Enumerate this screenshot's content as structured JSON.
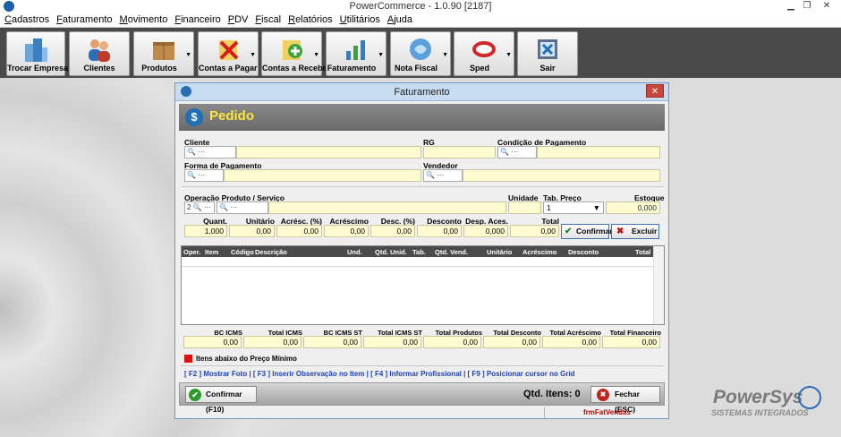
{
  "window": {
    "title": "PowerCommerce - 1.0.90 [2187]"
  },
  "menu": [
    "Cadastros",
    "Faturamento",
    "Movimento",
    "Financeiro",
    "PDV",
    "Fiscal",
    "Relatórios",
    "Utilitários",
    "Ajuda"
  ],
  "toolbar": [
    {
      "label": "Trocar Empresa",
      "icon": "buildings-icon",
      "dropdown": false
    },
    {
      "label": "Clientes",
      "icon": "users-icon",
      "dropdown": false
    },
    {
      "label": "Produtos",
      "icon": "boxes-icon",
      "dropdown": true
    },
    {
      "label": "Contas a Pagar",
      "icon": "bill-pay-icon",
      "dropdown": true
    },
    {
      "label": "Contas a Receber",
      "icon": "bill-receive-icon",
      "dropdown": true
    },
    {
      "label": "Faturamento",
      "icon": "chart-icon",
      "dropdown": true
    },
    {
      "label": "Nota Fiscal",
      "icon": "nfe-icon",
      "dropdown": true
    },
    {
      "label": "Sped",
      "icon": "sped-icon",
      "dropdown": true
    },
    {
      "label": "Sair",
      "icon": "exit-icon",
      "dropdown": false
    }
  ],
  "dialog": {
    "title": "Faturamento",
    "close": "✕",
    "header": "Pedido",
    "header_icon": "$",
    "fields": {
      "cliente_label": "Cliente",
      "rg_label": "RG",
      "cond_pag_label": "Condição de Pagamento",
      "forma_pag_label": "Forma de Pagamento",
      "vendedor_label": "Vendedor",
      "operacao_label": "Operação Produto / Serviço",
      "operacao_value": "2",
      "unidade_label": "Unidade",
      "tab_preco_label": "Tab. Preço",
      "tab_preco_value": "1",
      "estoque_label": "Estoque",
      "estoque_value": "0,000"
    },
    "item_headers": [
      "Quant.",
      "Unitário",
      "Acrésc. (%)",
      "Acréscimo",
      "Desc. (%)",
      "Desconto",
      "Desp. Aces.",
      "Total"
    ],
    "item_values": [
      "1,000",
      "0,00",
      "0,00",
      "0,00",
      "0,00",
      "0,00",
      "0,000",
      "0,00"
    ],
    "confirm_item": "Confirmar",
    "delete_item": "Excluir",
    "grid_columns": [
      "Oper.",
      "Item",
      "Código",
      "Descrição",
      "Und.",
      "Qtd. Unid.",
      "Tab.",
      "Qtd. Vend.",
      "Unitário",
      "Acréscimo",
      "Desconto",
      "Total"
    ],
    "totals_headers": [
      "BC ICMS",
      "Total ICMS",
      "BC ICMS ST",
      "Total ICMS ST",
      "Total Produtos",
      "Total Desconto",
      "Total Acréscimo",
      "Total Financeiro"
    ],
    "totals_values": [
      "0,00",
      "0,00",
      "0,00",
      "0,00",
      "0,00",
      "0,00",
      "0,00",
      "0,00"
    ],
    "legend": "Itens abaixo do Preço Mínimo",
    "hotkeys": "[ F2 ] Mostrar Foto  |  [ F3 ] Inserir Observação no Item  |  [ F4 ] Informar Profissional  |  [ F9 ] Posicionar cursor no Grid",
    "confirm": "Confirmar (F10)",
    "qtd_itens": "Qtd. Itens: 0",
    "close_btn": "Fechar (ESC)",
    "form_name": "frmFatVendas"
  },
  "brand": {
    "line1": "PowerSys",
    "line2": "SISTEMAS INTEGRADOS"
  }
}
